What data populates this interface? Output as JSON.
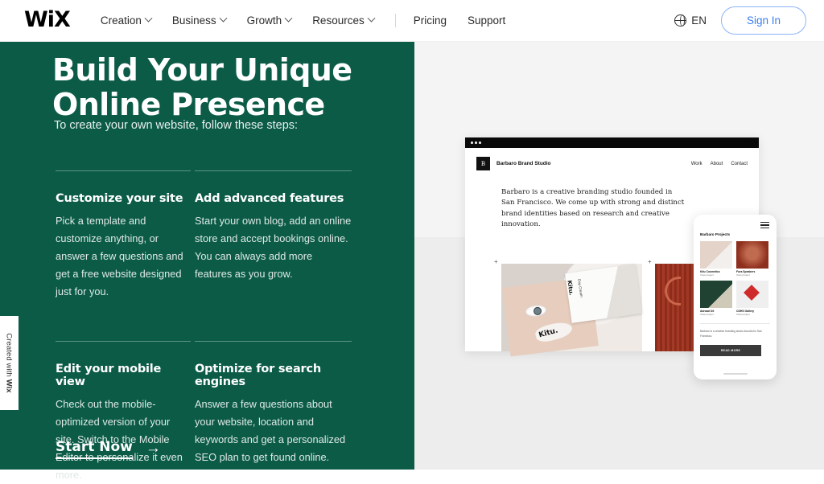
{
  "header": {
    "logo": "WiX",
    "nav": [
      {
        "label": "Creation",
        "has_caret": true
      },
      {
        "label": "Business",
        "has_caret": true
      },
      {
        "label": "Growth",
        "has_caret": true
      },
      {
        "label": "Resources",
        "has_caret": true
      },
      {
        "label": "Pricing",
        "has_caret": false
      },
      {
        "label": "Support",
        "has_caret": false
      }
    ],
    "language": "EN",
    "sign_in": "Sign In",
    "accent_blue": "#3a7df0"
  },
  "hero": {
    "headline_line1": "Build Your Unique",
    "headline_line2": "Online Presence",
    "subhead": "To create your own website, follow these steps:",
    "cta_label": "Start Now",
    "cta_arrow": "→",
    "background_green": "#0b5b47"
  },
  "steps": [
    {
      "title": "Customize your site",
      "body": "Pick a template and customize anything, or answer a few questions and get a free website designed just for you."
    },
    {
      "title": "Add advanced features",
      "body": "Start your own blog, add an online store and accept bookings online. You can always add more features as you grow."
    },
    {
      "title": "Edit your mobile view",
      "body": "Check out the mobile-optimized version of your site. Switch to the Mobile Editor to personalize it even more."
    },
    {
      "title": "Optimize for search engines",
      "body": "Answer a few questions about your website, location and keywords and get a personalized SEO plan to get found online."
    }
  ],
  "created_badge": {
    "prefix": "Created with ",
    "brand": "Wix"
  },
  "browser_mockup": {
    "logo_letter": "B",
    "brand": "Barbaro Brand Studio",
    "nav": [
      "Work",
      "About",
      "Contact"
    ],
    "copy": "Barbaro is a creative branding studio founded in San Francisco. We come up with strong and distinct brand identities based on research and creative innovation.",
    "gallery": [
      {
        "name": "kitu-cosmetics-image",
        "brand_mark": "Kitu.",
        "product": "Day Cream"
      },
      {
        "name": "fura-speakers-image"
      }
    ]
  },
  "phone_mockup": {
    "title": "Barbaro Projects",
    "projects": [
      {
        "caption": "Kitu Cosmetics",
        "subcaption": "View project"
      },
      {
        "caption": "Fura Speakers",
        "subcaption": "View project"
      },
      {
        "caption": "Abroad Oil",
        "subcaption": "View project"
      },
      {
        "caption": "CDHS Gallery",
        "subcaption": "View project"
      }
    ],
    "copy": "Barbaro is a creative branding studio founded in San Francisco.",
    "button": "READ MORE"
  }
}
